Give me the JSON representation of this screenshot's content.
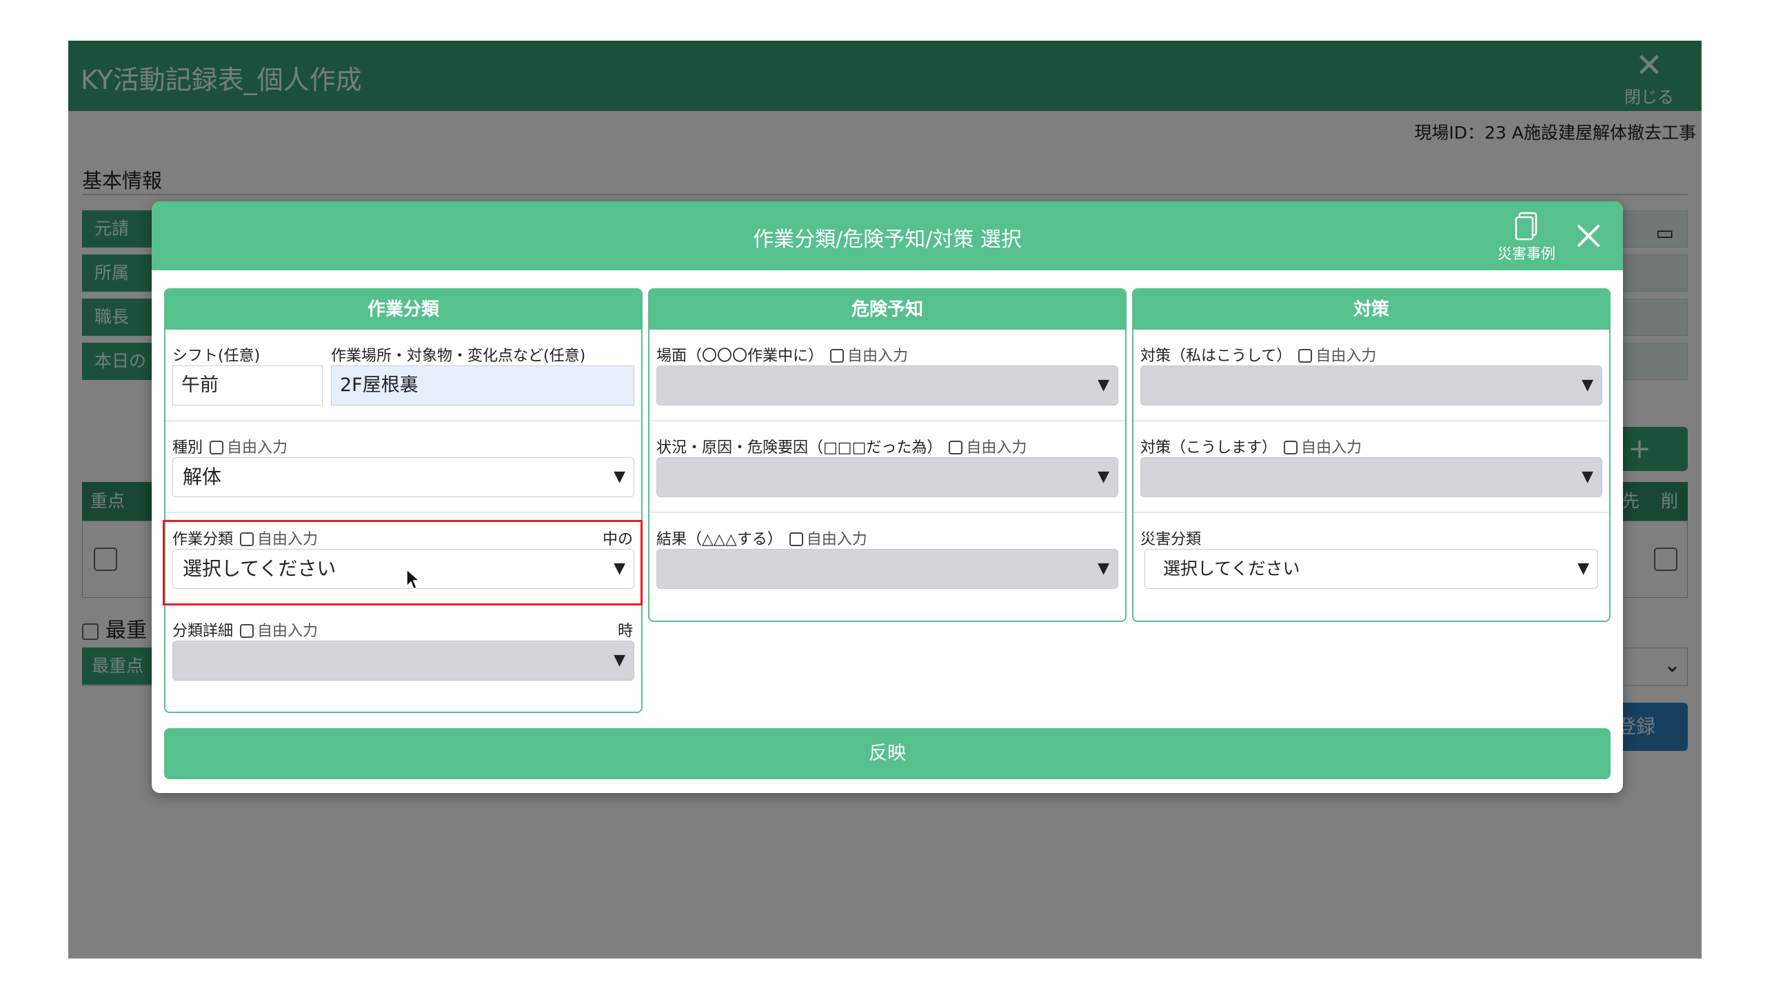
{
  "app": {
    "title": "KY活動記録表_個人作成",
    "close_label": "閉じる",
    "site_id": "現場ID：23 A施設建屋解体撤去工事",
    "basic_info": "基本情報",
    "labels": [
      "元請",
      "所属",
      "職長",
      "本日の"
    ],
    "table_headers": {
      "priority": "重点",
      "first": "先",
      "delete": "削"
    },
    "priority_check_label": "最重",
    "priority_select_label": "最重点",
    "add_label": "+",
    "submit_label": "登録"
  },
  "modal": {
    "title": "作業分類/危険予知/対策 選択",
    "casebook_label": "災害事例",
    "apply_label": "反映",
    "free_input_label": "自由入力",
    "columns": {
      "work": {
        "header": "作業分類",
        "shift_label": "シフト(任意)",
        "shift_value": "午前",
        "place_label": "作業場所・対象物・変化点など(任意)",
        "place_value": "2F屋根裏",
        "type_label": "種別",
        "type_value": "解体",
        "category_label": "作業分類",
        "category_note": "中の",
        "category_value": "選択してください",
        "detail_label": "分類詳細",
        "detail_note": "時"
      },
      "hazard": {
        "header": "危険予知",
        "scene_label": "場面（〇〇〇作業中に）",
        "cause_label": "状況・原因・危険要因（□□□だった為）",
        "result_label": "結果（△△△する）"
      },
      "measure": {
        "header": "対策",
        "measure1_label": "対策（私はこうして）",
        "measure2_label": "対策（こうします）",
        "disaster_label": "災害分類",
        "disaster_value": "選択してください"
      }
    }
  },
  "colors": {
    "modal_green": "#56c08f",
    "app_green": "#36a375",
    "highlight_red": "#e0202a",
    "submit_blue": "#2f7fc1"
  },
  "icons": [
    "close-icon",
    "document-icon",
    "chevron-down-icon",
    "calendar-icon",
    "mouse-cursor-icon"
  ]
}
